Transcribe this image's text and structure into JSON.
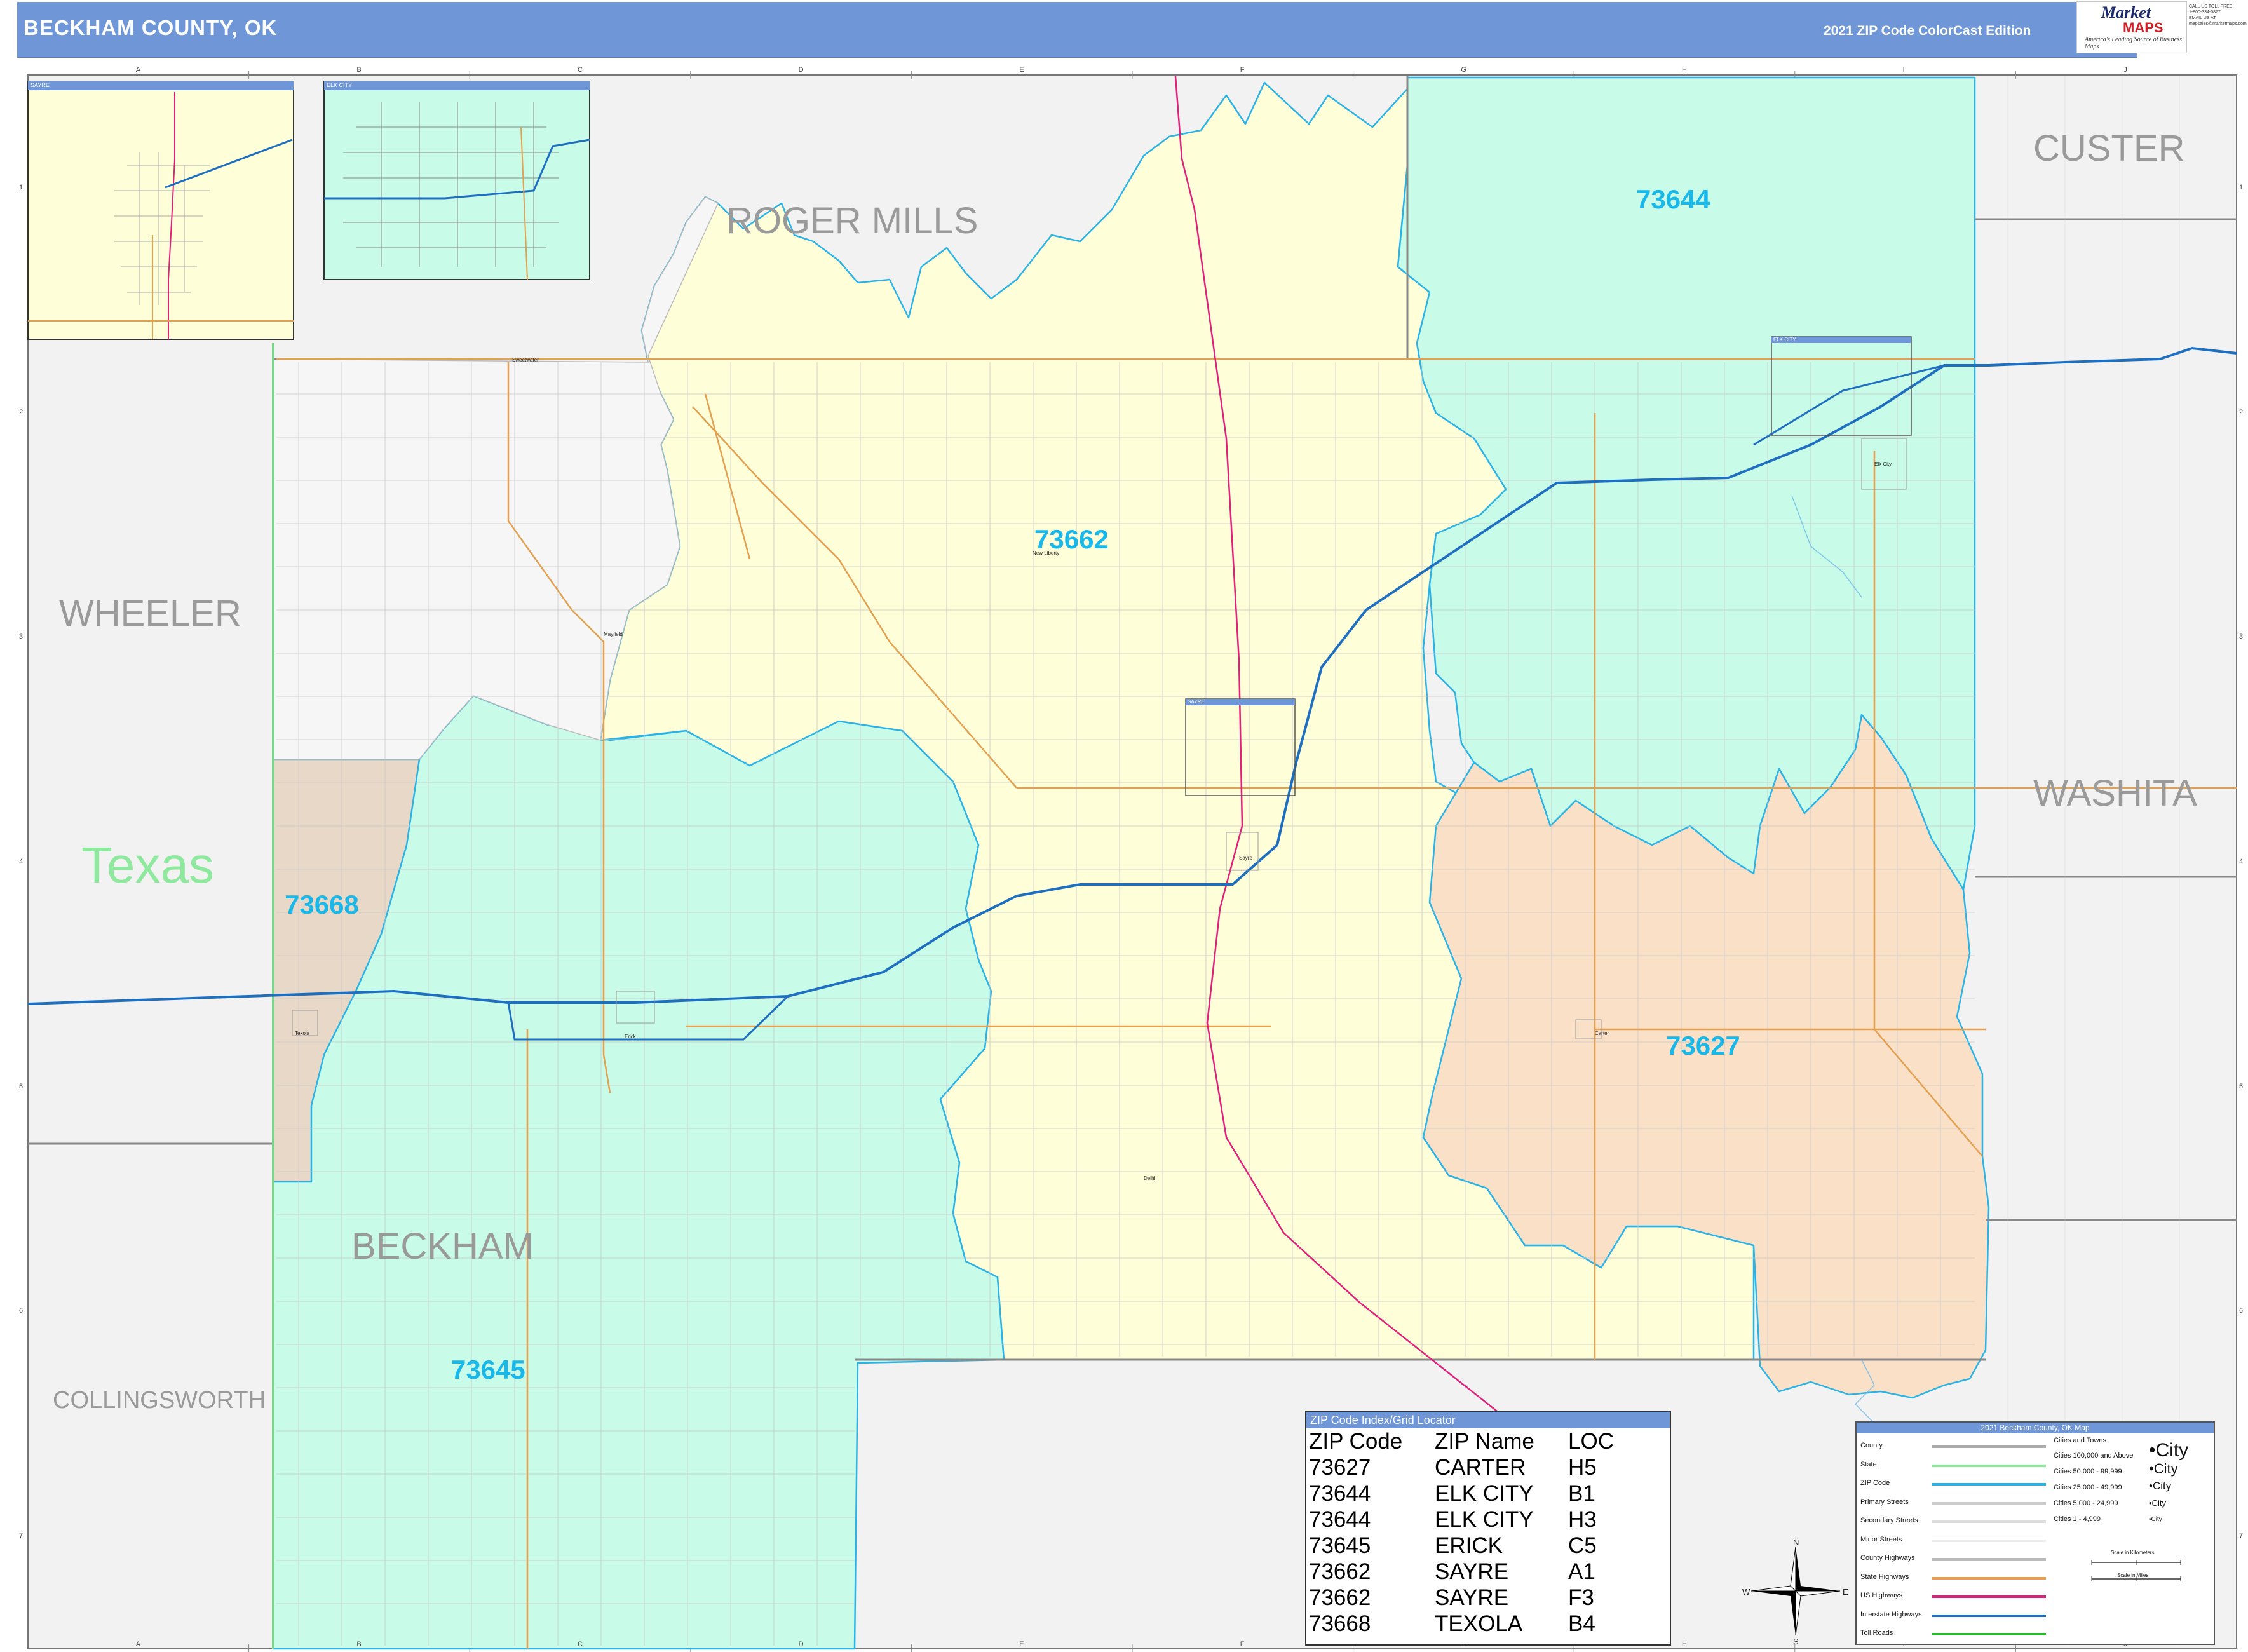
{
  "header": {
    "title": "BECKHAM COUNTY, OK",
    "edition": "2021 ZIP Code ColorCast Edition"
  },
  "logo": {
    "brand_top": "Market",
    "brand_bottom": "MAPS",
    "tagline": "America's Leading Source of Business Maps",
    "contact": [
      "CALL US TOLL FREE",
      "1-800-334-0877",
      "EMAIL US AT",
      "mapsales@marketmaps.com"
    ]
  },
  "grid": {
    "columns": [
      "A",
      "B",
      "C",
      "D",
      "E",
      "F",
      "G",
      "H",
      "I",
      "J"
    ],
    "rows": [
      "1",
      "2",
      "3",
      "4",
      "5",
      "6",
      "7"
    ]
  },
  "counties": {
    "roger_mills": "ROGER MILLS",
    "custer": "CUSTER",
    "wheeler": "WHEELER",
    "washita": "WASHITA",
    "beckham": "BECKHAM",
    "collingsworth": "COLLINGSWORTH"
  },
  "state_label": "Texas",
  "zips": {
    "z73644": "73644",
    "z73662": "73662",
    "z73668": "73668",
    "z73627": "73627",
    "z73645": "73645"
  },
  "zip_colors": {
    "73644": "#c8fbe8",
    "73645": "#c8fbe8",
    "73662": "#fefed8",
    "73627": "#fbe0c8",
    "73668": "#e8d8c8",
    "outside": "#f2f2f2"
  },
  "places": {
    "sweetwater": "Sweetwater",
    "new_liberty": "New Liberty",
    "mayfield": "Mayfield",
    "carter": "Carter",
    "delhi": "Delhi",
    "erick": "Erick",
    "texola": "Texola",
    "sayre": "Sayre",
    "elk_city": "Elk City"
  },
  "insets": {
    "sayre": "SAYRE",
    "elk_city": "ELK CITY"
  },
  "zip_index": {
    "title": "ZIP Code Index/Grid Locator",
    "headers": [
      "ZIP Code",
      "ZIP Name",
      "LOC"
    ],
    "rows": [
      [
        "73627",
        "CARTER",
        "H5"
      ],
      [
        "73644",
        "ELK CITY",
        "B1"
      ],
      [
        "73644",
        "ELK CITY",
        "H3"
      ],
      [
        "73645",
        "ERICK",
        "C5"
      ],
      [
        "73662",
        "SAYRE",
        "A1"
      ],
      [
        "73662",
        "SAYRE",
        "F3"
      ],
      [
        "73668",
        "TEXOLA",
        "B4"
      ]
    ]
  },
  "legend": {
    "title": "2021 Beckham County, OK Map",
    "line_items": [
      "County",
      "State",
      "ZIP Code",
      "Primary Streets",
      "Secondary Streets",
      "Minor Streets",
      "County Highways",
      "State Highways",
      "US Highways",
      "Interstate Highways",
      "Toll Roads"
    ],
    "cities_title": "Cities and Towns",
    "city_items": [
      [
        "Cities 100,000 and Above",
        "City"
      ],
      [
        "Cities 50,000 - 99,999",
        "City"
      ],
      [
        "Cities 25,000 - 49,999",
        "City"
      ],
      [
        "Cities 5,000 - 24,999",
        "City"
      ],
      [
        "Cities 1 - 4,999",
        "City"
      ]
    ],
    "scale_km": "Scale in Kilometers",
    "scale_mi": "Scale in Miles"
  },
  "compass": {
    "n": "N",
    "s": "S",
    "e": "E",
    "w": "W"
  },
  "colors": {
    "header": "#6f97d8",
    "zip_line": "#2bb3e6",
    "interstate": "#1f6fc0",
    "us_highway": "#e0207a",
    "state_highway": "#e2a050",
    "zip_label": "#1ab8e8",
    "county_label": "#9a9a9a",
    "texas_label": "#8ee89e"
  }
}
